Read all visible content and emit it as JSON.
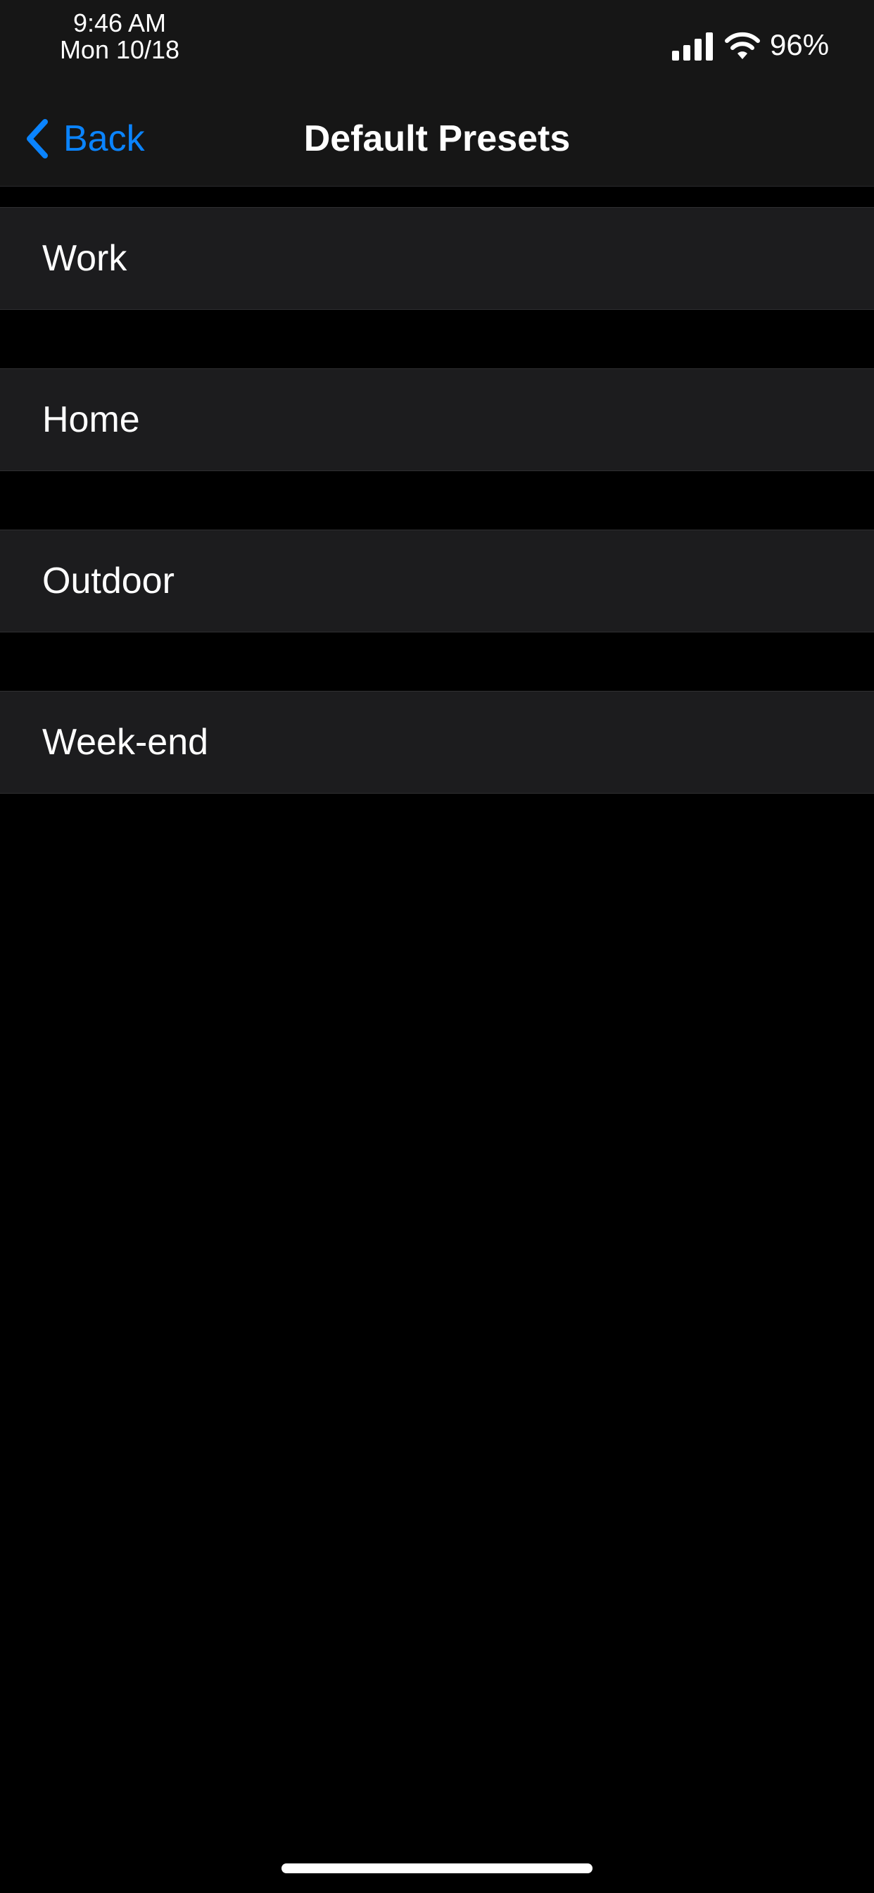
{
  "status_bar": {
    "time": "9:46 AM",
    "date": "Mon 10/18",
    "battery": "96%",
    "icons": [
      "signal-icon",
      "wifi-icon"
    ]
  },
  "nav": {
    "back_label": "Back",
    "title": "Default Presets"
  },
  "presets": [
    {
      "label": "Work"
    },
    {
      "label": "Home"
    },
    {
      "label": "Outdoor"
    },
    {
      "label": "Week-end"
    }
  ],
  "colors": {
    "accent": "#0a84ff",
    "background": "#000000",
    "row": "#1c1c1e",
    "header": "#161616"
  }
}
